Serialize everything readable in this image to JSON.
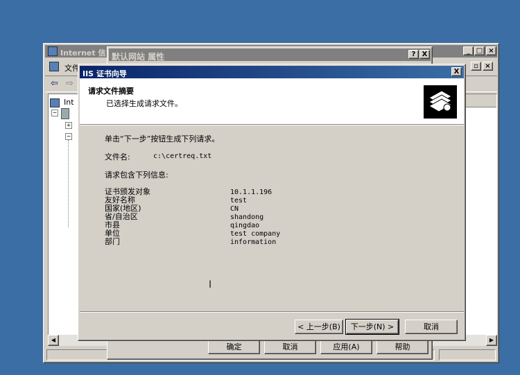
{
  "mmc": {
    "title": "Internet 信",
    "menu_label": "文件",
    "tree_root": "Int"
  },
  "props": {
    "title": "默认网站 属性",
    "help_glyph": "?",
    "close_glyph": "X",
    "buttons": {
      "ok": "确定",
      "cancel": "取消",
      "apply": "应用(A)",
      "help": "帮助"
    }
  },
  "wizard": {
    "title": "IIS 证书向导",
    "close_glyph": "X",
    "header": {
      "title": "请求文件摘要",
      "subtitle": "已选择生成请求文件。"
    },
    "instruction": "单击“下一步”按钮生成下列请求。",
    "file_label": "文件名:",
    "file_value": "c:\\certreq.txt",
    "info_label": "请求包含下列信息:",
    "info": [
      {
        "label": "证书颁发对象",
        "value": "10.1.1.196"
      },
      {
        "label": "友好名称",
        "value": "test"
      },
      {
        "label": "国家(地区)",
        "value": "CN"
      },
      {
        "label": "省/自治区",
        "value": "shandong"
      },
      {
        "label": "市县",
        "value": "qingdao"
      },
      {
        "label": "单位",
        "value": "test company"
      },
      {
        "label": "部门",
        "value": "information"
      }
    ],
    "buttons": {
      "back": "< 上一步(B)",
      "next": "下一步(N) >",
      "cancel": "取消"
    }
  }
}
